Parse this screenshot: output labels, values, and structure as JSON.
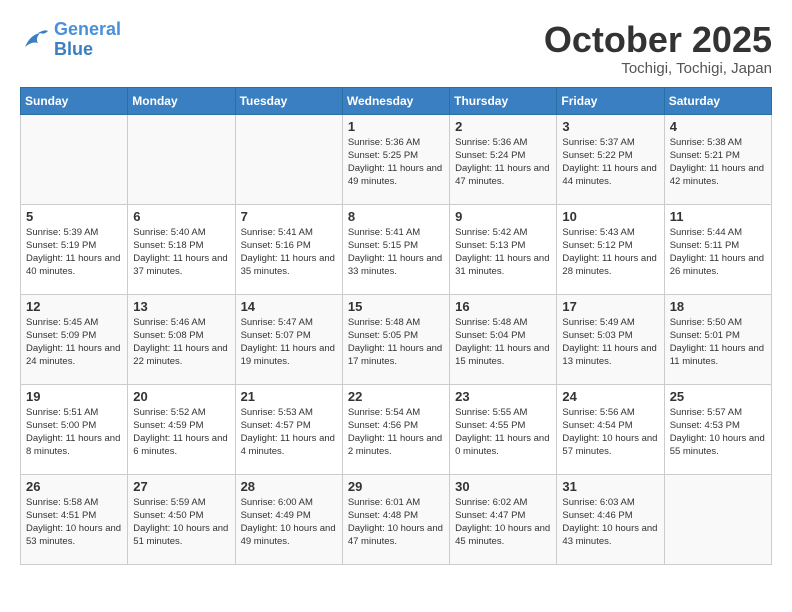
{
  "header": {
    "logo_line1": "General",
    "logo_line2": "Blue",
    "month": "October 2025",
    "location": "Tochigi, Tochigi, Japan"
  },
  "weekdays": [
    "Sunday",
    "Monday",
    "Tuesday",
    "Wednesday",
    "Thursday",
    "Friday",
    "Saturday"
  ],
  "weeks": [
    [
      {
        "day": "",
        "info": ""
      },
      {
        "day": "",
        "info": ""
      },
      {
        "day": "",
        "info": ""
      },
      {
        "day": "1",
        "info": "Sunrise: 5:36 AM\nSunset: 5:25 PM\nDaylight: 11 hours and 49 minutes."
      },
      {
        "day": "2",
        "info": "Sunrise: 5:36 AM\nSunset: 5:24 PM\nDaylight: 11 hours and 47 minutes."
      },
      {
        "day": "3",
        "info": "Sunrise: 5:37 AM\nSunset: 5:22 PM\nDaylight: 11 hours and 44 minutes."
      },
      {
        "day": "4",
        "info": "Sunrise: 5:38 AM\nSunset: 5:21 PM\nDaylight: 11 hours and 42 minutes."
      }
    ],
    [
      {
        "day": "5",
        "info": "Sunrise: 5:39 AM\nSunset: 5:19 PM\nDaylight: 11 hours and 40 minutes."
      },
      {
        "day": "6",
        "info": "Sunrise: 5:40 AM\nSunset: 5:18 PM\nDaylight: 11 hours and 37 minutes."
      },
      {
        "day": "7",
        "info": "Sunrise: 5:41 AM\nSunset: 5:16 PM\nDaylight: 11 hours and 35 minutes."
      },
      {
        "day": "8",
        "info": "Sunrise: 5:41 AM\nSunset: 5:15 PM\nDaylight: 11 hours and 33 minutes."
      },
      {
        "day": "9",
        "info": "Sunrise: 5:42 AM\nSunset: 5:13 PM\nDaylight: 11 hours and 31 minutes."
      },
      {
        "day": "10",
        "info": "Sunrise: 5:43 AM\nSunset: 5:12 PM\nDaylight: 11 hours and 28 minutes."
      },
      {
        "day": "11",
        "info": "Sunrise: 5:44 AM\nSunset: 5:11 PM\nDaylight: 11 hours and 26 minutes."
      }
    ],
    [
      {
        "day": "12",
        "info": "Sunrise: 5:45 AM\nSunset: 5:09 PM\nDaylight: 11 hours and 24 minutes."
      },
      {
        "day": "13",
        "info": "Sunrise: 5:46 AM\nSunset: 5:08 PM\nDaylight: 11 hours and 22 minutes."
      },
      {
        "day": "14",
        "info": "Sunrise: 5:47 AM\nSunset: 5:07 PM\nDaylight: 11 hours and 19 minutes."
      },
      {
        "day": "15",
        "info": "Sunrise: 5:48 AM\nSunset: 5:05 PM\nDaylight: 11 hours and 17 minutes."
      },
      {
        "day": "16",
        "info": "Sunrise: 5:48 AM\nSunset: 5:04 PM\nDaylight: 11 hours and 15 minutes."
      },
      {
        "day": "17",
        "info": "Sunrise: 5:49 AM\nSunset: 5:03 PM\nDaylight: 11 hours and 13 minutes."
      },
      {
        "day": "18",
        "info": "Sunrise: 5:50 AM\nSunset: 5:01 PM\nDaylight: 11 hours and 11 minutes."
      }
    ],
    [
      {
        "day": "19",
        "info": "Sunrise: 5:51 AM\nSunset: 5:00 PM\nDaylight: 11 hours and 8 minutes."
      },
      {
        "day": "20",
        "info": "Sunrise: 5:52 AM\nSunset: 4:59 PM\nDaylight: 11 hours and 6 minutes."
      },
      {
        "day": "21",
        "info": "Sunrise: 5:53 AM\nSunset: 4:57 PM\nDaylight: 11 hours and 4 minutes."
      },
      {
        "day": "22",
        "info": "Sunrise: 5:54 AM\nSunset: 4:56 PM\nDaylight: 11 hours and 2 minutes."
      },
      {
        "day": "23",
        "info": "Sunrise: 5:55 AM\nSunset: 4:55 PM\nDaylight: 11 hours and 0 minutes."
      },
      {
        "day": "24",
        "info": "Sunrise: 5:56 AM\nSunset: 4:54 PM\nDaylight: 10 hours and 57 minutes."
      },
      {
        "day": "25",
        "info": "Sunrise: 5:57 AM\nSunset: 4:53 PM\nDaylight: 10 hours and 55 minutes."
      }
    ],
    [
      {
        "day": "26",
        "info": "Sunrise: 5:58 AM\nSunset: 4:51 PM\nDaylight: 10 hours and 53 minutes."
      },
      {
        "day": "27",
        "info": "Sunrise: 5:59 AM\nSunset: 4:50 PM\nDaylight: 10 hours and 51 minutes."
      },
      {
        "day": "28",
        "info": "Sunrise: 6:00 AM\nSunset: 4:49 PM\nDaylight: 10 hours and 49 minutes."
      },
      {
        "day": "29",
        "info": "Sunrise: 6:01 AM\nSunset: 4:48 PM\nDaylight: 10 hours and 47 minutes."
      },
      {
        "day": "30",
        "info": "Sunrise: 6:02 AM\nSunset: 4:47 PM\nDaylight: 10 hours and 45 minutes."
      },
      {
        "day": "31",
        "info": "Sunrise: 6:03 AM\nSunset: 4:46 PM\nDaylight: 10 hours and 43 minutes."
      },
      {
        "day": "",
        "info": ""
      }
    ]
  ]
}
